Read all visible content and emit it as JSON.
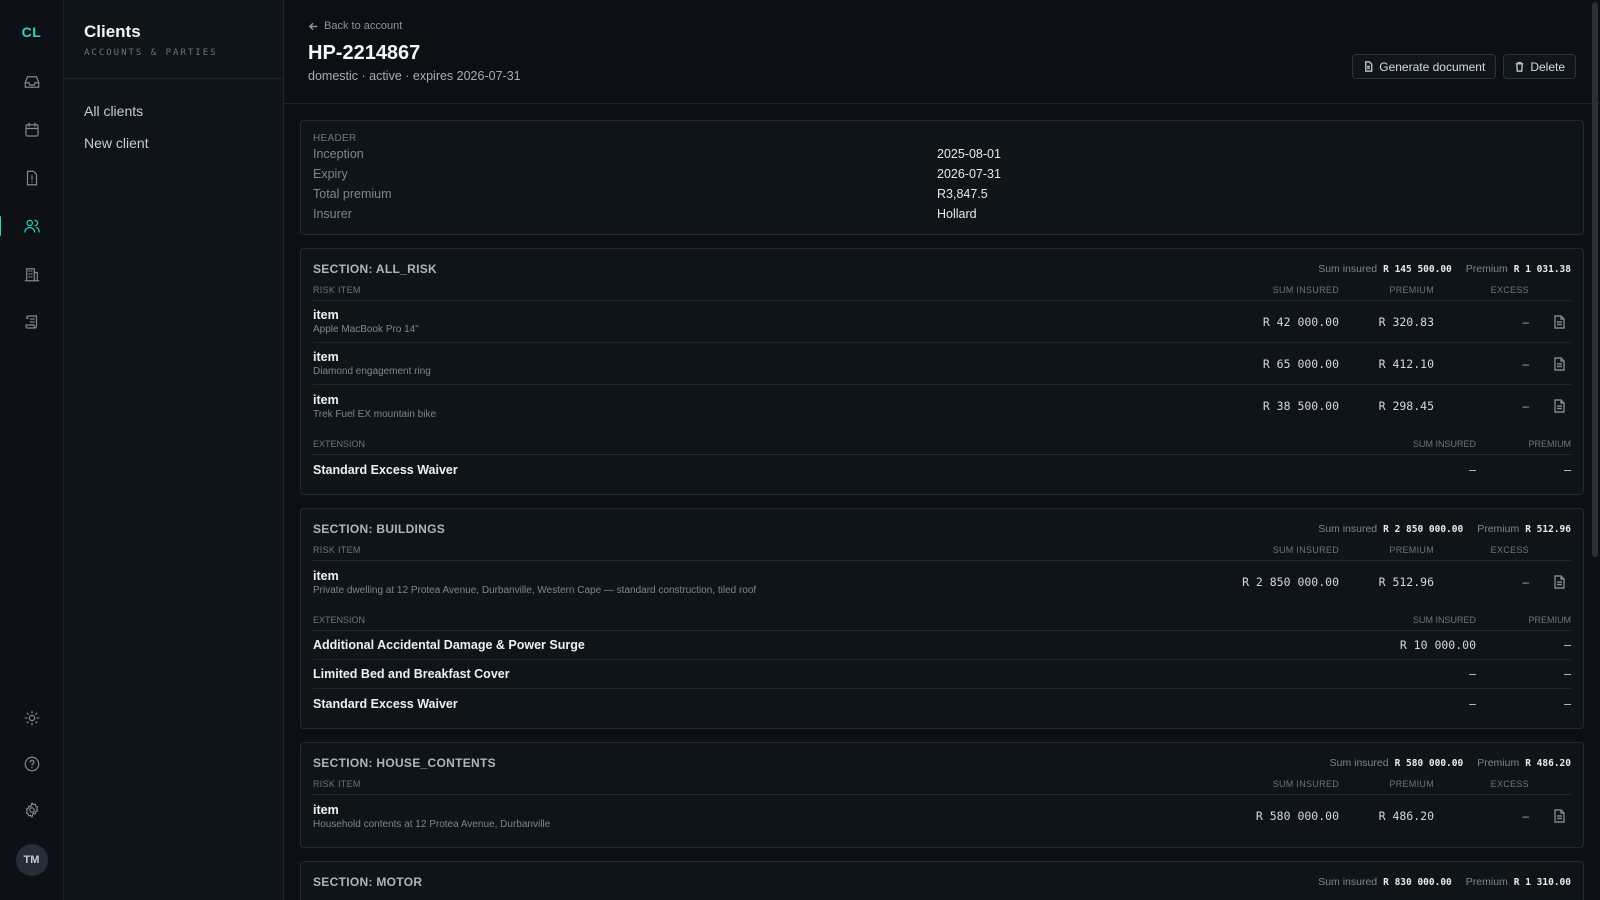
{
  "rail": {
    "logo": "CL",
    "nav": [
      {
        "name": "inbox-icon"
      },
      {
        "name": "calendar-icon"
      },
      {
        "name": "alert-document-icon"
      },
      {
        "name": "users-icon",
        "active": true
      },
      {
        "name": "building-icon"
      },
      {
        "name": "scroll-icon"
      }
    ],
    "bottom": [
      "sun-icon",
      "help-icon",
      "gear-icon"
    ],
    "avatar": "TM"
  },
  "subnav": {
    "title": "Clients",
    "subtitle": "ACCOUNTS & PARTIES",
    "items": [
      "All clients",
      "New client"
    ]
  },
  "header": {
    "back_label": "Back to account",
    "title": "HP-2214867",
    "meta": "domestic · active · expires 2026-07-31",
    "generate_label": "Generate document",
    "delete_label": "Delete"
  },
  "summary": {
    "label": "HEADER",
    "rows": [
      {
        "k": "Inception",
        "v": "2025-08-01"
      },
      {
        "k": "Expiry",
        "v": "2026-07-31"
      },
      {
        "k": "Total premium",
        "v": "R3,847.5"
      },
      {
        "k": "Insurer",
        "v": "Hollard"
      }
    ]
  },
  "labels": {
    "sum_insured": "Sum insured",
    "premium": "Premium",
    "risk_item": "RISK ITEM",
    "col_sum": "SUM INSURED",
    "col_premium": "PREMIUM",
    "col_excess": "EXCESS",
    "extension": "EXTENSION"
  },
  "sections": [
    {
      "title": "SECTION: ALL_RISK",
      "sum": "R 145 500.00",
      "premium": "R 1 031.38",
      "items": [
        {
          "name": "item",
          "desc": "Apple MacBook Pro 14\"",
          "sum": "R 42 000.00",
          "premium": "R 320.83",
          "excess": "–"
        },
        {
          "name": "item",
          "desc": "Diamond engagement ring",
          "sum": "R 65 000.00",
          "premium": "R 412.10",
          "excess": "–"
        },
        {
          "name": "item",
          "desc": "Trek Fuel EX mountain bike",
          "sum": "R 38 500.00",
          "premium": "R 298.45",
          "excess": "–"
        }
      ],
      "extensions": [
        {
          "name": "Standard Excess Waiver",
          "sum": "–",
          "premium": "–"
        }
      ]
    },
    {
      "title": "SECTION: BUILDINGS",
      "sum": "R 2 850 000.00",
      "premium": "R 512.96",
      "items": [
        {
          "name": "item",
          "desc": "Private dwelling at 12 Protea Avenue, Durbanville, Western Cape — standard construction, tiled roof",
          "sum": "R 2 850 000.00",
          "premium": "R 512.96",
          "excess": "–"
        }
      ],
      "extensions": [
        {
          "name": "Additional Accidental Damage & Power Surge",
          "sum": "R 10 000.00",
          "premium": "–"
        },
        {
          "name": "Limited Bed and Breakfast Cover",
          "sum": "–",
          "premium": "–"
        },
        {
          "name": "Standard Excess Waiver",
          "sum": "–",
          "premium": "–"
        }
      ]
    },
    {
      "title": "SECTION: HOUSE_CONTENTS",
      "sum": "R 580 000.00",
      "premium": "R 486.20",
      "items": [
        {
          "name": "item",
          "desc": "Household contents at 12 Protea Avenue, Durbanville",
          "sum": "R 580 000.00",
          "premium": "R 486.20",
          "excess": "–"
        }
      ],
      "extensions": []
    },
    {
      "title": "SECTION: MOTOR",
      "sum": "R 830 000.00",
      "premium": "R 1 310.00",
      "items": [],
      "extensions": []
    }
  ]
}
